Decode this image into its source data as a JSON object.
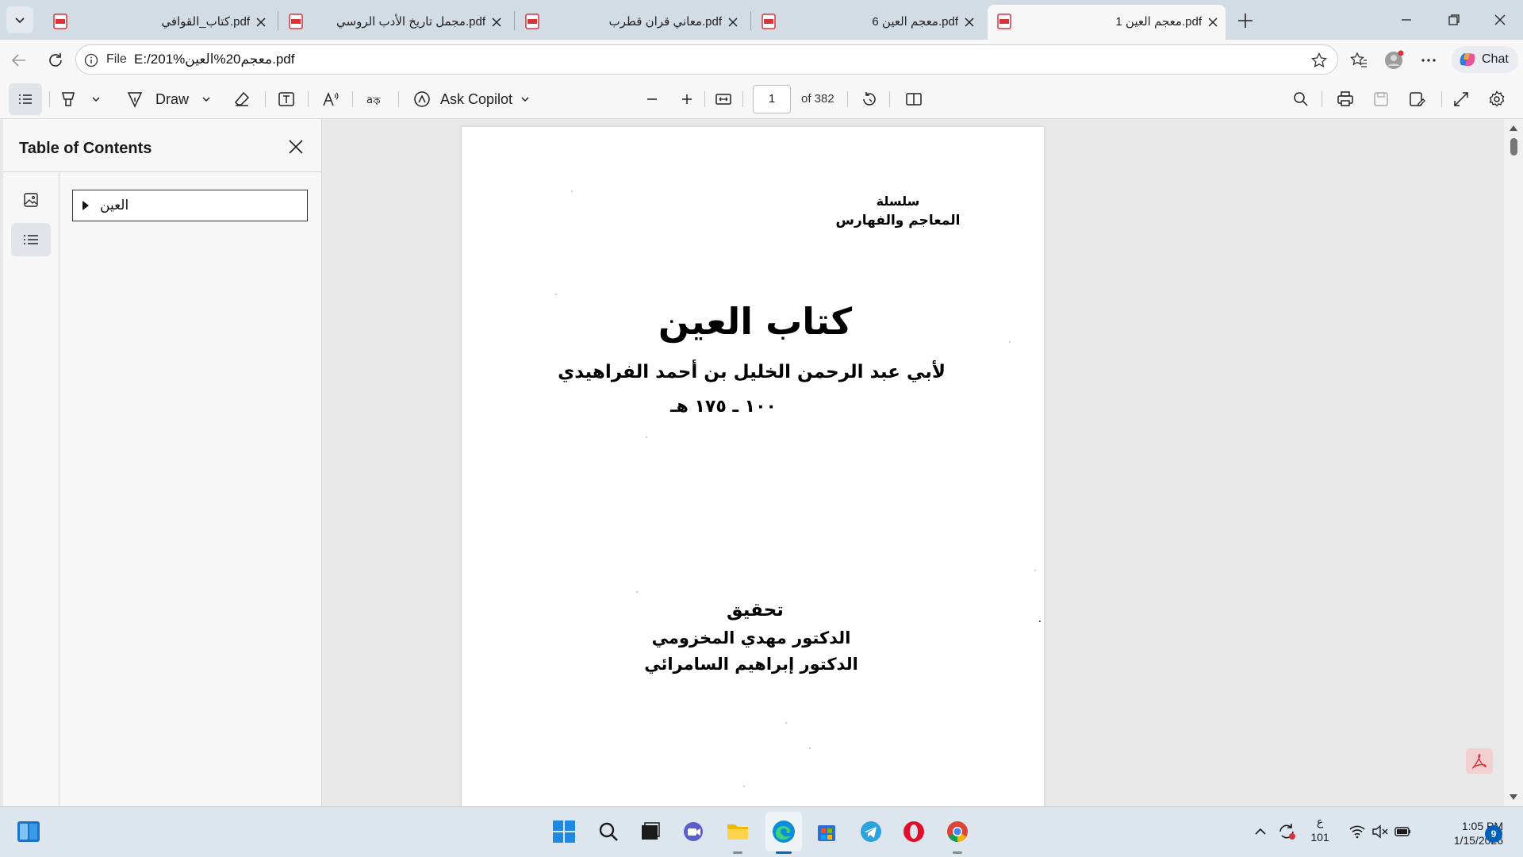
{
  "tabs": [
    {
      "title": "كتاب_القوافي.pdf"
    },
    {
      "title": "مجمل تاريخ الأدب الروسي.pdf"
    },
    {
      "title": "معاني قران قطرب.pdf"
    },
    {
      "title": "معجم العين 6.pdf"
    },
    {
      "title": "معجم العين 1.pdf",
      "active": true
    }
  ],
  "address": {
    "file_label": "File",
    "url": "E:/201%معجم20%العين.pdf"
  },
  "chat_label": "Chat",
  "toolbar": {
    "draw_label": "Draw",
    "ask_copilot_label": "Ask Copilot",
    "current_page": "1",
    "total_pages": "of 382"
  },
  "sidebar": {
    "title": "Table of Contents",
    "toc_items": [
      {
        "label": "العين"
      }
    ]
  },
  "document": {
    "series_line1": "سلسلة",
    "series_line2": "المعاجم والفهارس",
    "book_title": "كتاب العين",
    "author": "لأبي عبد الرحمن الخليل بن أحمد الفراهيدي",
    "dates": "١٠٠ ـ ١٧٥ هـ",
    "editing_label": "تحقيق",
    "editor1": "الدكتور مهدي المخزومي",
    "editor2": "الدكتور إبراهيم السامرائي"
  },
  "taskbar": {
    "keyboard_lang": "ع",
    "keyboard_num": "101",
    "time": "1:05 PM",
    "date": "1/15/2026",
    "notification_count": "9"
  },
  "colors": {
    "accent": "#0067c0",
    "tab_strip": "#d3dbe4",
    "toolbar_bg": "#f7f7f7",
    "pdf_icon_red": "#d9333a"
  }
}
